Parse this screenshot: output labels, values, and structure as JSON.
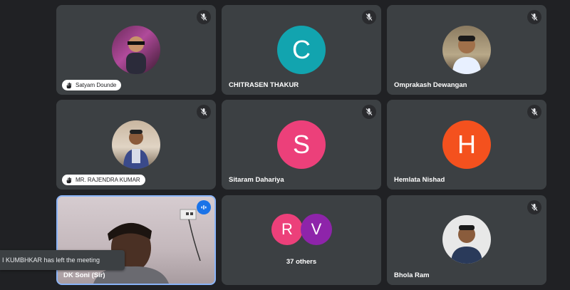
{
  "participants": [
    {
      "name": "Satyam Dounde",
      "avatar": "photo"
    },
    {
      "name": "CHITRASEN THAKUR",
      "avatar_letter": "C",
      "avatar_color": "#12a4af"
    },
    {
      "name": "Omprakash Dewangan",
      "avatar": "photo"
    },
    {
      "name": "MR. RAJENDRA KUMAR",
      "avatar": "photo"
    },
    {
      "name": "Sitaram Dahariya",
      "avatar_letter": "S",
      "avatar_color": "#ec407a"
    },
    {
      "name": "Hemlata Nishad",
      "avatar_letter": "H",
      "avatar_color": "#f4511e"
    },
    {
      "name": "DK Soni (Sir)",
      "avatar": "video"
    },
    {
      "avatar_letters": [
        "R",
        "V"
      ],
      "avatar_colors": [
        "#ec407a",
        "#8e24aa"
      ],
      "label": "37 others"
    },
    {
      "name": "Bhola Ram",
      "avatar": "photo"
    }
  ],
  "toast": {
    "text": "I KUMBHKAR has left the meeting"
  },
  "colors": {
    "background": "#202124",
    "tile": "#3c4043",
    "active_border": "#8ab4f8",
    "accent": "#1a73e8"
  }
}
